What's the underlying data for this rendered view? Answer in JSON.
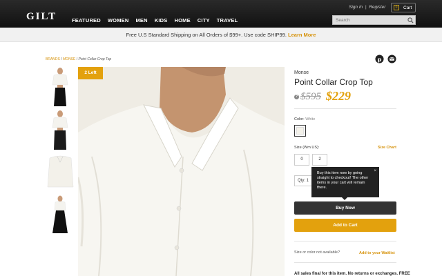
{
  "header": {
    "logo": "GILT",
    "nav": [
      "FEATURED",
      "WOMEN",
      "MEN",
      "KIDS",
      "HOME",
      "CITY",
      "TRAVEL"
    ],
    "sign_in": "Sign In",
    "separator": "|",
    "register": "Register",
    "cart_count": "0",
    "cart_label": "Cart",
    "search_placeholder": "Search",
    "search_icon": "search-icon"
  },
  "promo": {
    "text": "Free U.S Standard Shipping on All Orders of $99+. Use code SHIP99.",
    "link": "Learn More"
  },
  "breadcrumb": {
    "brands": "BRANDS",
    "sep1": " / ",
    "brand": "MONSE",
    "sep2": " / ",
    "current": "Point Collar Crop Top"
  },
  "badge": "2 Left",
  "product": {
    "brand": "Monse",
    "title": "Point Collar Crop Top",
    "info_icon": "?",
    "old_price": "$595",
    "new_price": "$229",
    "color_label": "Color:",
    "color_value": "White",
    "size_label": "Size (Wm US):",
    "size_chart": "Size Chart",
    "sizes": [
      "0",
      "2"
    ],
    "qty_label": "Qty: 1",
    "tooltip": "Buy this item now by going straight to checkout! The other items in your cart will remain there.",
    "tooltip_close": "×",
    "buy_now": "Buy Now",
    "add_to_cart": "Add to Cart",
    "waitlist_question": "Size or color not available?",
    "waitlist_link": "Add to your Waitlist",
    "bottom_text": "All sales final for this item. No returns or exchanges. FREE"
  },
  "colors": {
    "accent": "#e3a10d",
    "header_bg": "#111111",
    "buy_now_bg": "#333333"
  }
}
